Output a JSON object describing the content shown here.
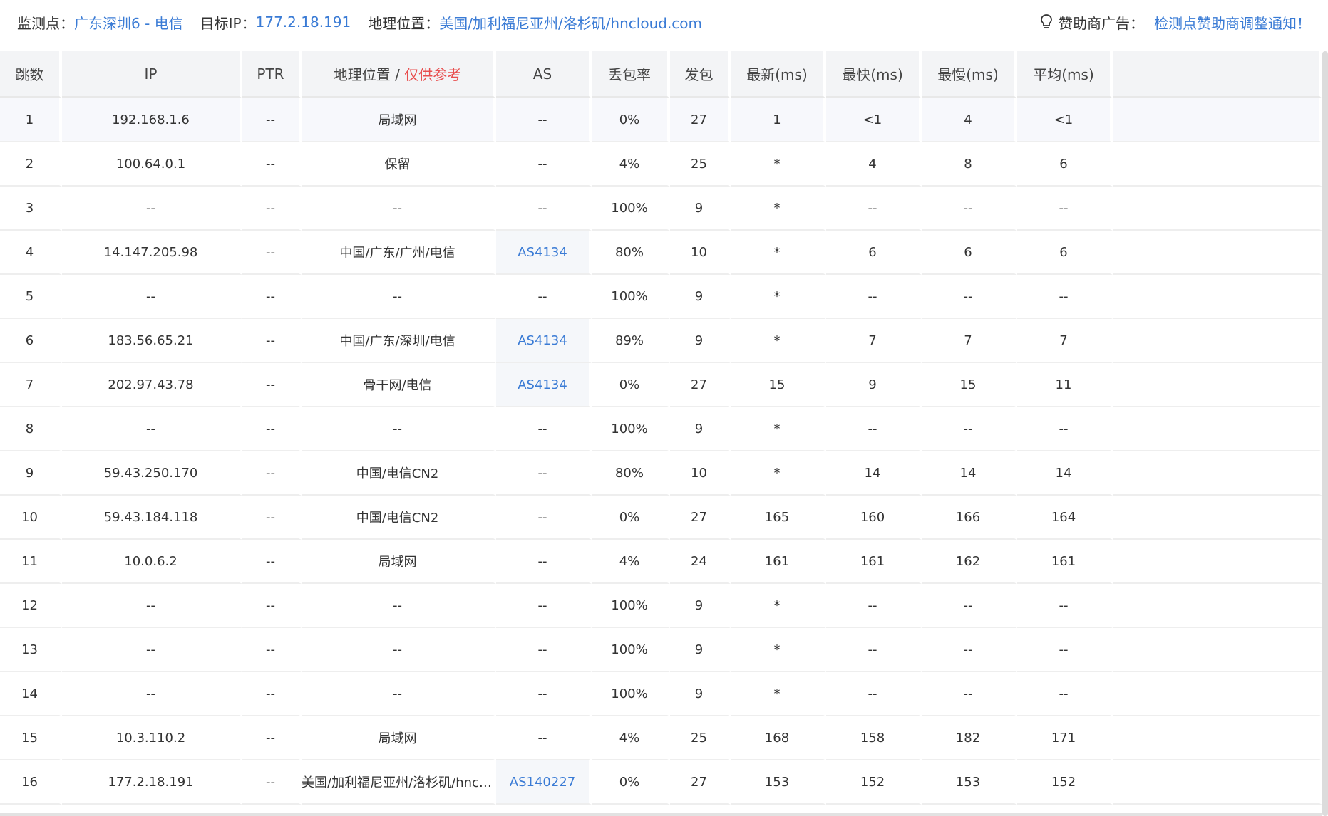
{
  "info": {
    "monitor_label": "监测点：",
    "monitor_value": "广东深圳6 - 电信",
    "target_label": "目标IP：",
    "target_value": "177.2.18.191",
    "geo_label": "地理位置：",
    "geo_value": "美国/加利福尼亚州/洛杉矶/hncloud.com",
    "sponsor_icon": "lightbulb-icon",
    "sponsor_label": "赞助商广告：",
    "sponsor_link": "检测点赞助商调整通知！"
  },
  "columns": {
    "hop": "跳数",
    "ip": "IP",
    "ptr": "PTR",
    "geo": "地理位置 / ",
    "geo_ref": "仅供参考",
    "as": "AS",
    "loss": "丢包率",
    "sent": "发包",
    "last": "最新(ms)",
    "best": "最快(ms)",
    "worst": "最慢(ms)",
    "avg": "平均(ms)"
  },
  "rows": [
    {
      "hop": "1",
      "ip": "192.168.1.6",
      "ptr": "--",
      "geo": "局域网",
      "as": "--",
      "loss": "0%",
      "sent": "27",
      "last": "1",
      "best": "<1",
      "worst": "4",
      "avg": "<1"
    },
    {
      "hop": "2",
      "ip": "100.64.0.1",
      "ptr": "--",
      "geo": "保留",
      "as": "--",
      "loss": "4%",
      "sent": "25",
      "last": "*",
      "best": "4",
      "worst": "8",
      "avg": "6"
    },
    {
      "hop": "3",
      "ip": "--",
      "ptr": "--",
      "geo": "--",
      "as": "--",
      "loss": "100%",
      "sent": "9",
      "last": "*",
      "best": "--",
      "worst": "--",
      "avg": "--"
    },
    {
      "hop": "4",
      "ip": "14.147.205.98",
      "ptr": "--",
      "geo": "中国/广东/广州/电信",
      "as": "AS4134",
      "loss": "80%",
      "sent": "10",
      "last": "*",
      "best": "6",
      "worst": "6",
      "avg": "6"
    },
    {
      "hop": "5",
      "ip": "--",
      "ptr": "--",
      "geo": "--",
      "as": "--",
      "loss": "100%",
      "sent": "9",
      "last": "*",
      "best": "--",
      "worst": "--",
      "avg": "--"
    },
    {
      "hop": "6",
      "ip": "183.56.65.21",
      "ptr": "--",
      "geo": "中国/广东/深圳/电信",
      "as": "AS4134",
      "loss": "89%",
      "sent": "9",
      "last": "*",
      "best": "7",
      "worst": "7",
      "avg": "7"
    },
    {
      "hop": "7",
      "ip": "202.97.43.78",
      "ptr": "--",
      "geo": "骨干网/电信",
      "as": "AS4134",
      "loss": "0%",
      "sent": "27",
      "last": "15",
      "best": "9",
      "worst": "15",
      "avg": "11"
    },
    {
      "hop": "8",
      "ip": "--",
      "ptr": "--",
      "geo": "--",
      "as": "--",
      "loss": "100%",
      "sent": "9",
      "last": "*",
      "best": "--",
      "worst": "--",
      "avg": "--"
    },
    {
      "hop": "9",
      "ip": "59.43.250.170",
      "ptr": "--",
      "geo": "中国/电信CN2",
      "as": "--",
      "loss": "80%",
      "sent": "10",
      "last": "*",
      "best": "14",
      "worst": "14",
      "avg": "14"
    },
    {
      "hop": "10",
      "ip": "59.43.184.118",
      "ptr": "--",
      "geo": "中国/电信CN2",
      "as": "--",
      "loss": "0%",
      "sent": "27",
      "last": "165",
      "best": "160",
      "worst": "166",
      "avg": "164"
    },
    {
      "hop": "11",
      "ip": "10.0.6.2",
      "ptr": "--",
      "geo": "局域网",
      "as": "--",
      "loss": "4%",
      "sent": "24",
      "last": "161",
      "best": "161",
      "worst": "162",
      "avg": "161"
    },
    {
      "hop": "12",
      "ip": "--",
      "ptr": "--",
      "geo": "--",
      "as": "--",
      "loss": "100%",
      "sent": "9",
      "last": "*",
      "best": "--",
      "worst": "--",
      "avg": "--"
    },
    {
      "hop": "13",
      "ip": "--",
      "ptr": "--",
      "geo": "--",
      "as": "--",
      "loss": "100%",
      "sent": "9",
      "last": "*",
      "best": "--",
      "worst": "--",
      "avg": "--"
    },
    {
      "hop": "14",
      "ip": "--",
      "ptr": "--",
      "geo": "--",
      "as": "--",
      "loss": "100%",
      "sent": "9",
      "last": "*",
      "best": "--",
      "worst": "--",
      "avg": "--"
    },
    {
      "hop": "15",
      "ip": "10.3.110.2",
      "ptr": "--",
      "geo": "局域网",
      "as": "--",
      "loss": "4%",
      "sent": "25",
      "last": "168",
      "best": "158",
      "worst": "182",
      "avg": "171"
    },
    {
      "hop": "16",
      "ip": "177.2.18.191",
      "ptr": "--",
      "geo": "美国/加利福尼亚州/洛杉矶/hnclou...",
      "as": "AS140227",
      "loss": "0%",
      "sent": "27",
      "last": "153",
      "best": "152",
      "worst": "153",
      "avg": "152"
    }
  ]
}
